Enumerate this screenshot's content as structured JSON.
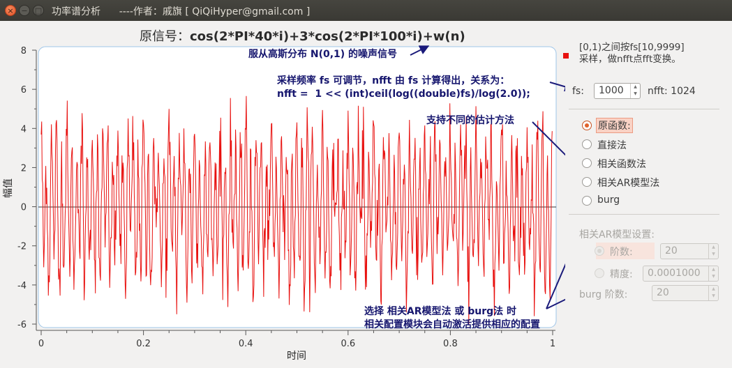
{
  "window": {
    "title": "功率谱分析      ----作者：戚旗 [ QiQiHyper@gmail.com ]",
    "buttons": {
      "close": "×",
      "minimize": "−",
      "maximize": "□"
    }
  },
  "plot": {
    "title_prefix": "原信号：",
    "title_formula": "cos(2*PI*40*i)+3*cos(2*PI*100*i)+w(n)",
    "xlabel": "时间",
    "ylabel": "幅值",
    "xticks": [
      "0",
      "0.2",
      "0.4",
      "0.6",
      "0.8",
      "1"
    ],
    "yticks": [
      "8",
      "6",
      "4",
      "2",
      "0",
      "-2",
      "-4",
      "-6"
    ]
  },
  "annotations": {
    "noise": "服从高斯分布 N(0,1) 的噪声信号",
    "sampling_line1": "采样频率 fs 可调节，nfft 由 fs 计算得出，关系为：",
    "sampling_line2": "nfft =  1 << (int)ceil(log((double)fs)/log(2.0));",
    "methods": "支持不同的估计方法",
    "config_line1": "选择 相关AR模型法 或 burg法 时",
    "config_line2": "相关配置模块会自动激活提供相应的配置"
  },
  "panel": {
    "sample_note_line1": "[0,1)之间按fs[10,9999]",
    "sample_note_line2": "采样，做nfft点fft变换。",
    "fs_label": "fs:",
    "fs_value": "1000",
    "nfft_label": "nfft:  1024",
    "methods": [
      {
        "label": "原函数:",
        "checked": true
      },
      {
        "label": "直接法",
        "checked": false
      },
      {
        "label": "相关函数法",
        "checked": false
      },
      {
        "label": "相关AR模型法",
        "checked": false
      },
      {
        "label": "burg",
        "checked": false
      }
    ],
    "ar_settings_title": "相关AR模型设置:",
    "order_label": "阶数:",
    "order_value": "20",
    "precision_label": "精度:",
    "precision_value": "0.0001000",
    "burg_order_label": "burg 阶数:",
    "burg_order_value": "20"
  },
  "colors": {
    "signal": "#e8110f",
    "annotation": "#16166e",
    "arrow": "#1a1a7a"
  },
  "chart_data": {
    "type": "line",
    "xlabel": "时间",
    "ylabel": "幅值",
    "xlim": [
      0,
      1
    ],
    "ylim": [
      -6,
      8
    ],
    "series": [
      {
        "description_free": true
      }
    ]
  }
}
